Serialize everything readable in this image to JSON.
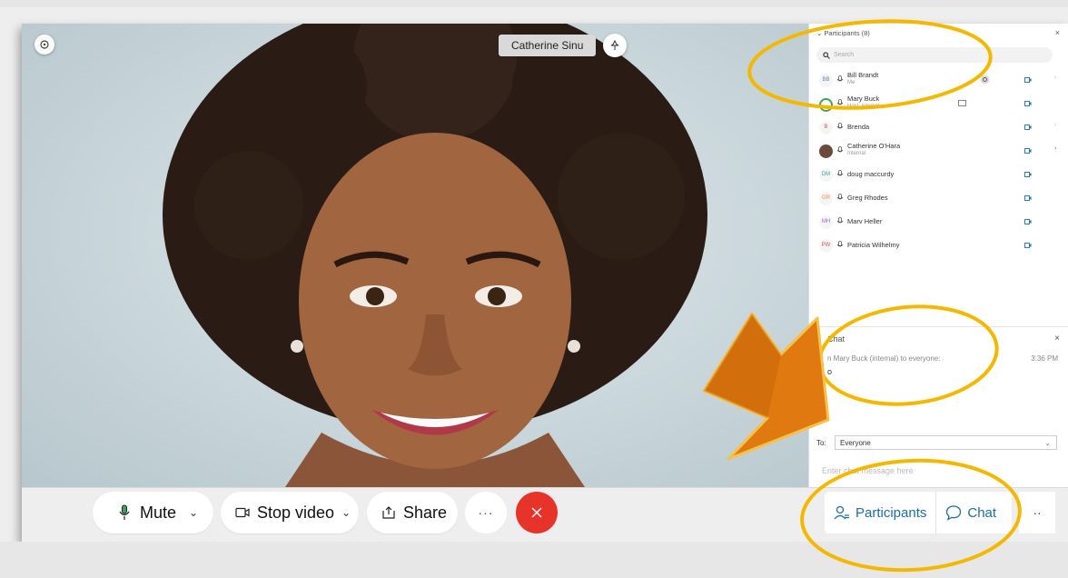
{
  "video": {
    "participant_name": "Catherine Sinu"
  },
  "participants_panel": {
    "title": "Participants (8)",
    "close": "×",
    "search_placeholder": "Search",
    "items": [
      {
        "initials": "BB",
        "name": "Bill Brandt",
        "subtitle": "Me",
        "extra": "›"
      },
      {
        "initials": "",
        "name": "Mary Buck",
        "subtitle": "Host, internal",
        "extra": ""
      },
      {
        "initials": "B",
        "name": "Brenda",
        "subtitle": "",
        "extra": "›"
      },
      {
        "initials": "",
        "name": "Catherine O'Hara",
        "subtitle": "Internal",
        "extra": "›"
      },
      {
        "initials": "DM",
        "name": "doug maccurdy",
        "subtitle": "",
        "extra": ""
      },
      {
        "initials": "GR",
        "name": "Greg Rhodes",
        "subtitle": "",
        "extra": ""
      },
      {
        "initials": "MH",
        "name": "Marv Heller",
        "subtitle": "",
        "extra": ""
      },
      {
        "initials": "PW",
        "name": "Patricia Wilhelmy",
        "subtitle": "",
        "extra": ""
      }
    ]
  },
  "chat_panel": {
    "title": "Chat",
    "close": "×",
    "from": "n Mary Buck (internal) to everyone:",
    "time": "3:36 PM",
    "message": "o",
    "to_label": "To:",
    "to_value": "Everyone",
    "input_placeholder": "Enter chat message here"
  },
  "toolbar": {
    "mute_label": "Mute",
    "stop_video_label": "Stop video",
    "share_label": "Share",
    "more_label": "···",
    "participants_label": "Participants",
    "chat_label": "Chat",
    "right_more_label": "··"
  },
  "colors": {
    "accent": "#1a6ea8",
    "end_call": "#e8332a",
    "highlight_ellipse": "#f5b800",
    "arrow": "#e07a10"
  }
}
